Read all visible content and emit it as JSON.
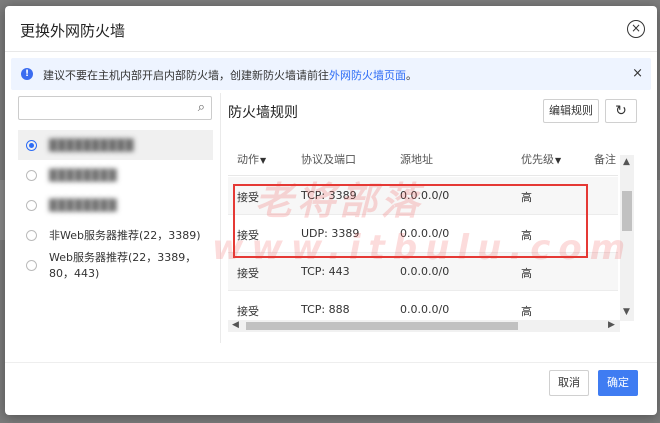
{
  "dialog": {
    "title": "更换外网防火墙",
    "close_icon": "×"
  },
  "alert": {
    "icon": "!",
    "text": "建议不要在主机内部开启内部防火墙，创建新防火墙请前往",
    "link": "外网防火墙页面",
    "suffix": "。",
    "close": "×"
  },
  "left": {
    "search_placeholder": "",
    "search_icon": "⌕",
    "items": [
      {
        "label": "██████████",
        "checked": true,
        "blurred": true
      },
      {
        "label": "████████",
        "checked": false,
        "blurred": true
      },
      {
        "label": "████████",
        "checked": false,
        "blurred": true
      },
      {
        "label": "非Web服务器推荐(22，3389)",
        "checked": false,
        "blurred": false
      },
      {
        "label": "Web服务器推荐(22，3389，80，443)",
        "checked": false,
        "blurred": false
      }
    ]
  },
  "right": {
    "title": "防火墙规则",
    "edit_button": "编辑规则",
    "refresh_icon": "↻",
    "columns": [
      "动作",
      "协议及端口",
      "源地址",
      "优先级",
      "备注"
    ],
    "sort_icon": "▼",
    "rows": [
      {
        "action": "接受",
        "proto": "TCP: 3389",
        "source": "0.0.0.0/0",
        "priority": "高",
        "note": ""
      },
      {
        "action": "接受",
        "proto": "UDP: 3389",
        "source": "0.0.0.0/0",
        "priority": "高",
        "note": ""
      },
      {
        "action": "接受",
        "proto": "TCP: 443",
        "source": "0.0.0.0/0",
        "priority": "高",
        "note": ""
      },
      {
        "action": "接受",
        "proto": "TCP: 888",
        "source": "0.0.0.0/0",
        "priority": "高",
        "note": ""
      }
    ]
  },
  "watermark": {
    "line1": "老将部落",
    "line2": "www.itbulu.com"
  },
  "footer": {
    "cancel": "取消",
    "ok": "确定"
  },
  "colors": {
    "accent": "#3f7cf2",
    "link": "#2d6cf5",
    "highlight": "#e53935"
  }
}
